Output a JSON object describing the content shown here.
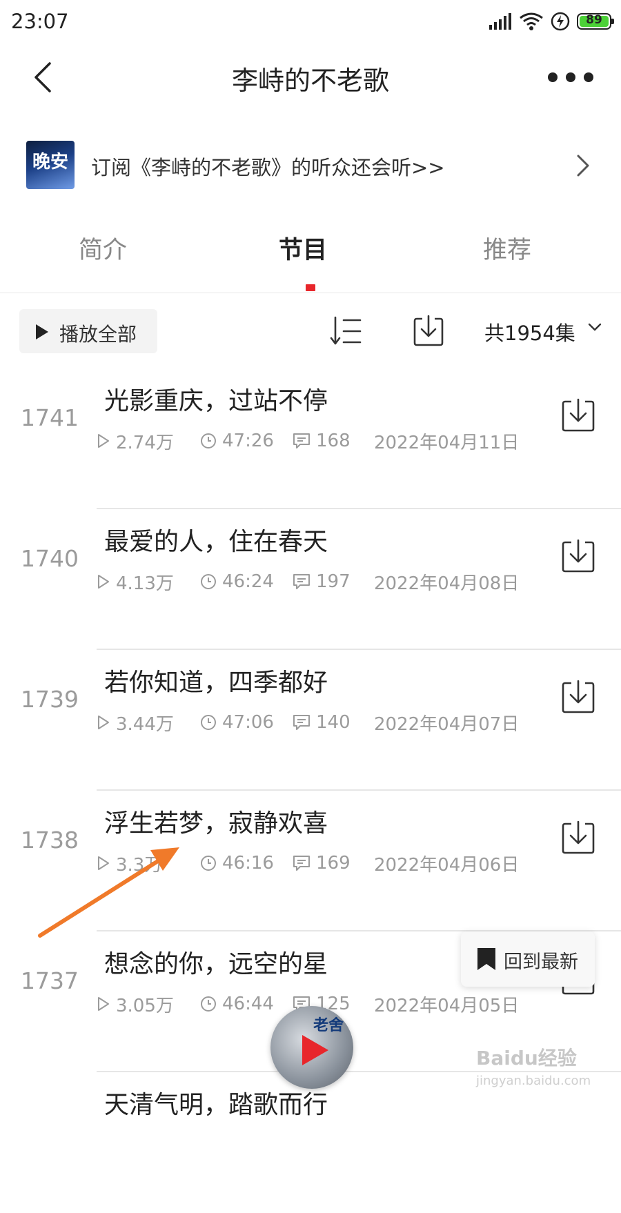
{
  "status_bar": {
    "time": "23:07",
    "battery": "89"
  },
  "nav": {
    "title": "李峙的不老歌"
  },
  "promo": {
    "cover_text": "晚安",
    "text": "订阅《李峙的不老歌》的听众还会听>>"
  },
  "tabs": [
    {
      "label": "简介",
      "active": false
    },
    {
      "label": "节目",
      "active": true
    },
    {
      "label": "推荐",
      "active": false
    }
  ],
  "toolbar": {
    "play_all_label": "播放全部",
    "episode_count": "共1954集"
  },
  "episodes": [
    {
      "number": "1741",
      "title": "光影重庆，过站不停",
      "plays": "2.74万",
      "duration": "47:26",
      "comments": "168",
      "date": "2022年04月11日"
    },
    {
      "number": "1740",
      "title": "最爱的人，住在春天",
      "plays": "4.13万",
      "duration": "46:24",
      "comments": "197",
      "date": "2022年04月08日"
    },
    {
      "number": "1739",
      "title": "若你知道，四季都好",
      "plays": "3.44万",
      "duration": "47:06",
      "comments": "140",
      "date": "2022年04月07日"
    },
    {
      "number": "1738",
      "title": "浮生若梦，寂静欢喜",
      "plays": "3.3万",
      "duration": "46:16",
      "comments": "169",
      "date": "2022年04月06日"
    },
    {
      "number": "1737",
      "title": "想念的你，远空的星",
      "plays": "3.05万",
      "duration": "46:44",
      "comments": "125",
      "date": "2022年04月05日"
    },
    {
      "number": "",
      "title": "天清气明，踏歌而行",
      "plays": "",
      "duration": "",
      "comments": "",
      "date": ""
    }
  ],
  "floating": {
    "back_to_latest": "回到最新"
  },
  "mini_player": {
    "badge": "老舍"
  },
  "watermark": {
    "main": "Baidu经验",
    "sub": "jingyan.baidu.com"
  },
  "colors": {
    "accent": "#e8262b",
    "annotation_arrow": "#f07a2a"
  }
}
